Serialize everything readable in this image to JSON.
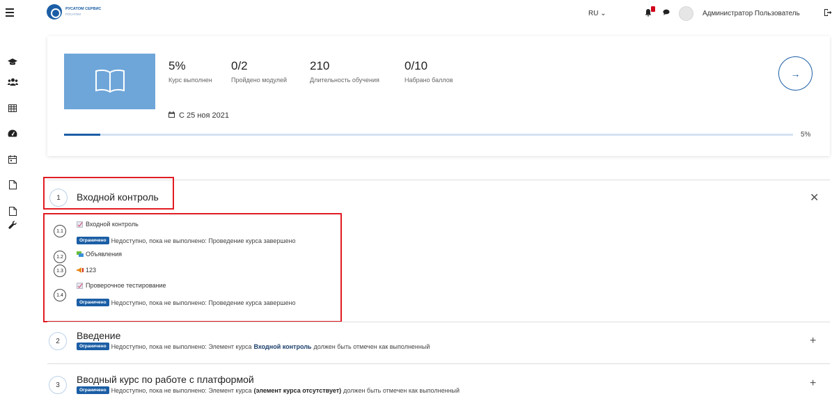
{
  "header": {
    "logo_line1": "РУСАТОМ СЕРВИС",
    "logo_line2": "РОСАТОМ",
    "language": "RU ⌄",
    "user_name": "Администратор Пользователь",
    "notification_count": ""
  },
  "sidebar": {
    "icons": [
      "graduation-cap-icon",
      "users-icon",
      "table-icon",
      "dashboard-icon",
      "calendar-icon",
      "file-icon",
      "file-icon",
      "wrench-icon"
    ]
  },
  "course": {
    "stats": [
      {
        "value": "5%",
        "label": "Курс выполнен"
      },
      {
        "value": "0/2",
        "label": "Пройдено модулей"
      },
      {
        "value": "210",
        "label": "Длительность обучения"
      },
      {
        "value": "0/10",
        "label": "Набрано баллов"
      }
    ],
    "date": "С 25 ноя 2021",
    "progress_percent": 5,
    "progress_label": "5%",
    "arrow": "→"
  },
  "restricted_badge": "Ограничено",
  "sections": [
    {
      "number": "1",
      "title": "Входной контроль",
      "toggle": "✕",
      "activities": [
        {
          "number": "1.1",
          "name": "Входной контроль",
          "restriction": "Недоступно, пока не выполнено: Проведение курса завершено"
        },
        {
          "number": "1.2",
          "name": "Объявления"
        },
        {
          "number": "1.3",
          "name": "123"
        },
        {
          "number": "1.4",
          "name": "Проверочное тестирование",
          "restriction": "Недоступно, пока не выполнено: Проведение курса завершено"
        }
      ]
    },
    {
      "number": "2",
      "title": "Введение",
      "toggle": "+",
      "restriction_pre": "Недоступно, пока не выполнено: Элемент курса",
      "restriction_link": "Входной контроль",
      "restriction_post": "должен быть отмечен как выполненный"
    },
    {
      "number": "3",
      "title": "Вводный курс по работе с платформой",
      "toggle": "+",
      "restriction_pre": "Недоступно, пока не выполнено: Элемент курса",
      "restriction_link": "(элемент курса отсутствует)",
      "restriction_post": "должен быть отмечен как выполненный"
    }
  ]
}
